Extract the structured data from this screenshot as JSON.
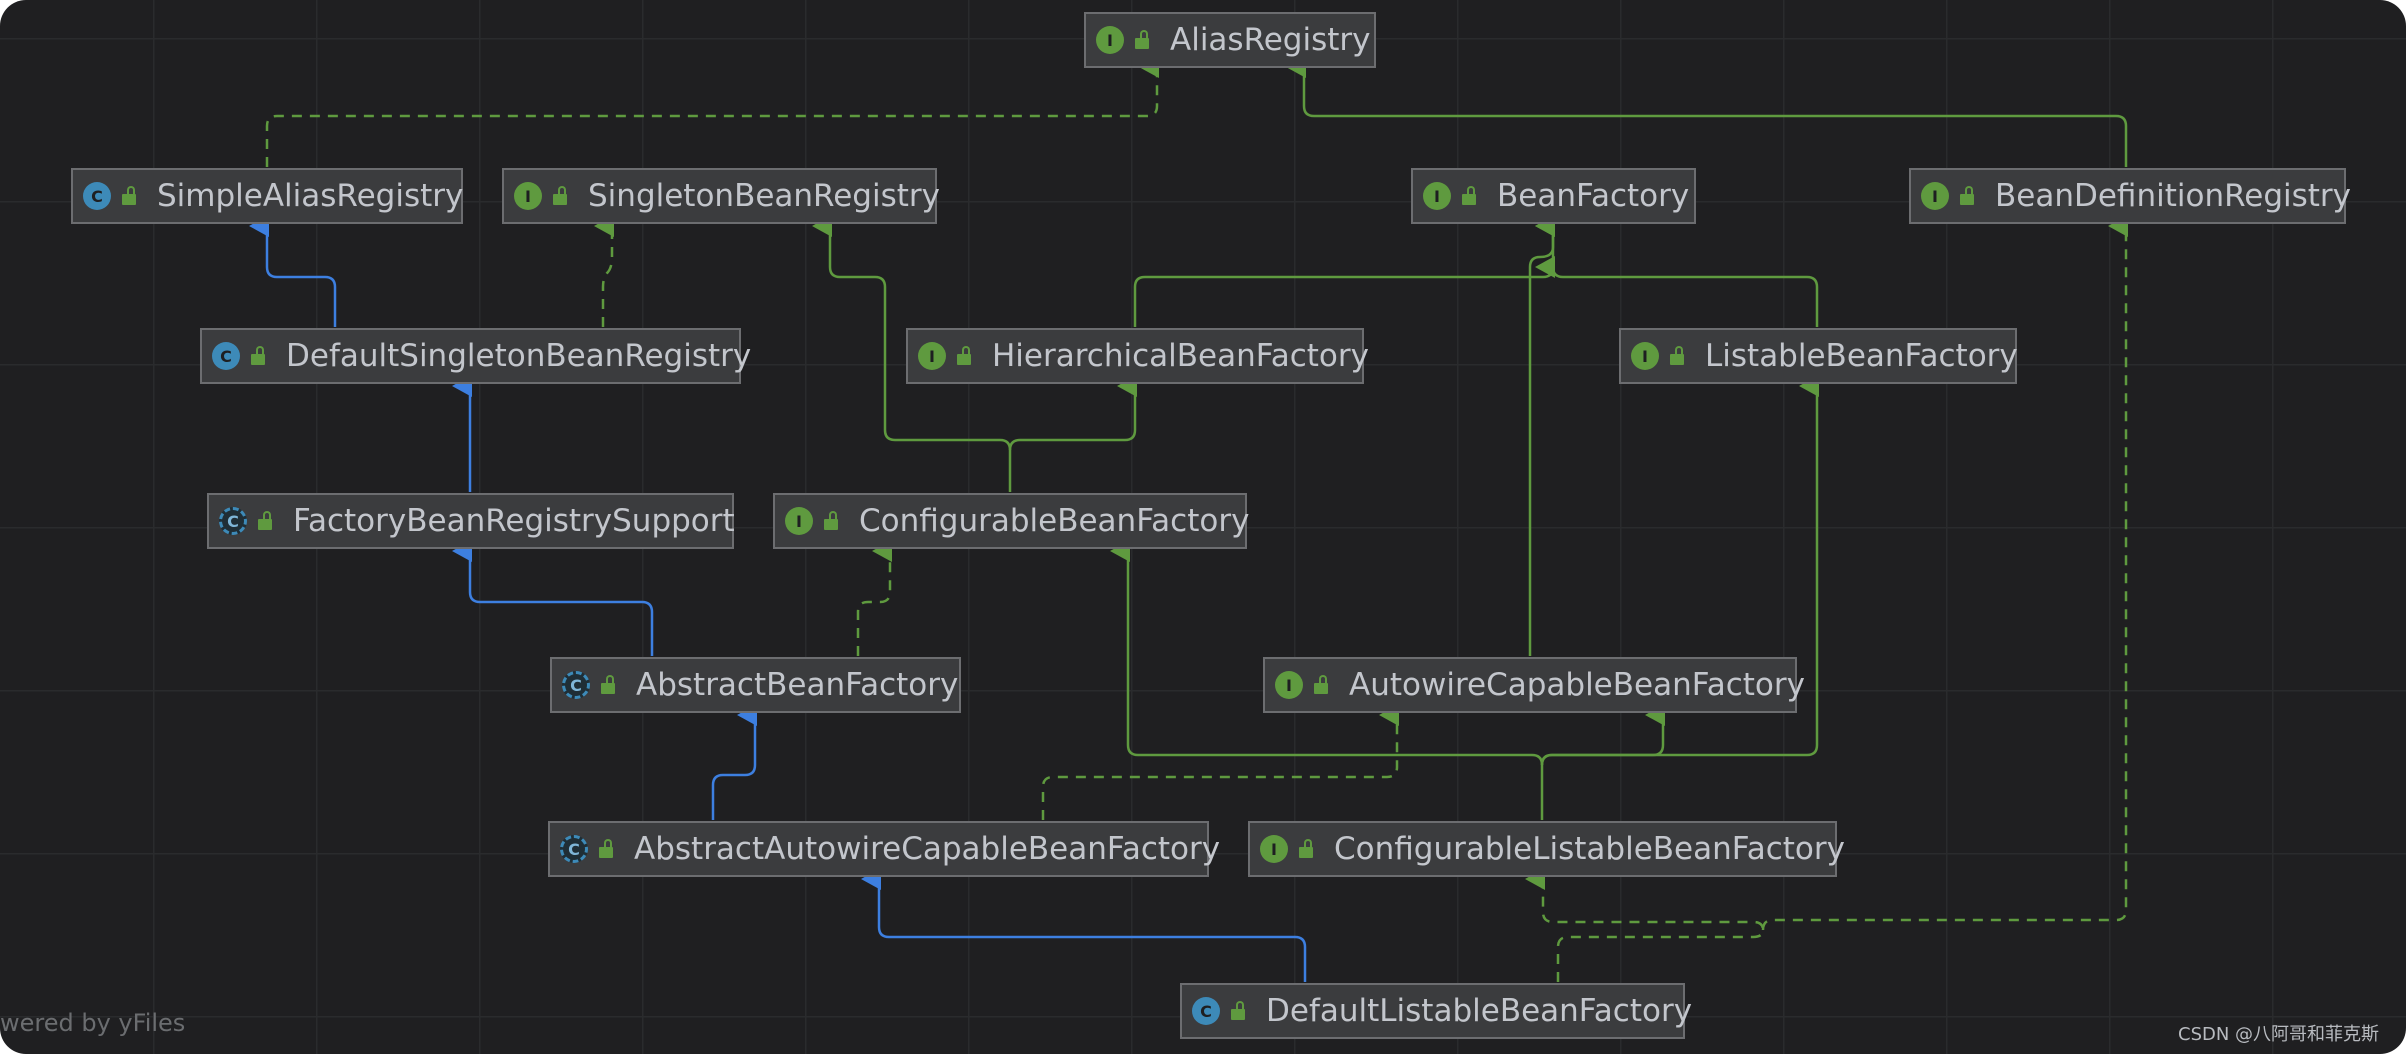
{
  "colors": {
    "implements_edge": "#5f9a3f",
    "extends_edge": "#3d7fe0",
    "interface_icon": "#5f9a3f",
    "class_icon": "#3d8ab8"
  },
  "nodes": {
    "alias_registry": {
      "label": "AliasRegistry",
      "kind": "interface",
      "kind_letter": "I"
    },
    "simple_alias_registry": {
      "label": "SimpleAliasRegistry",
      "kind": "class",
      "kind_letter": "C"
    },
    "singleton_bean_registry": {
      "label": "SingletonBeanRegistry",
      "kind": "interface",
      "kind_letter": "I"
    },
    "bean_factory": {
      "label": "BeanFactory",
      "kind": "interface",
      "kind_letter": "I"
    },
    "bean_definition_registry": {
      "label": "BeanDefinitionRegistry",
      "kind": "interface",
      "kind_letter": "I"
    },
    "default_singleton_bean_registry": {
      "label": "DefaultSingletonBeanRegistry",
      "kind": "class",
      "kind_letter": "C"
    },
    "hierarchical_bean_factory": {
      "label": "HierarchicalBeanFactory",
      "kind": "interface",
      "kind_letter": "I"
    },
    "listable_bean_factory": {
      "label": "ListableBeanFactory",
      "kind": "interface",
      "kind_letter": "I"
    },
    "factory_bean_registry_support": {
      "label": "FactoryBeanRegistrySupport",
      "kind": "abstract",
      "kind_letter": "C"
    },
    "configurable_bean_factory": {
      "label": "ConfigurableBeanFactory",
      "kind": "interface",
      "kind_letter": "I"
    },
    "abstract_bean_factory": {
      "label": "AbstractBeanFactory",
      "kind": "abstract",
      "kind_letter": "C"
    },
    "autowire_capable_bean_factory": {
      "label": "AutowireCapableBeanFactory",
      "kind": "interface",
      "kind_letter": "I"
    },
    "abstract_autowire_capable_bean_factory": {
      "label": "AbstractAutowireCapableBeanFactory",
      "kind": "abstract",
      "kind_letter": "C"
    },
    "configurable_listable_bean_factory": {
      "label": "ConfigurableListableBeanFactory",
      "kind": "interface",
      "kind_letter": "I"
    },
    "default_listable_bean_factory": {
      "label": "DefaultListableBeanFactory",
      "kind": "class",
      "kind_letter": "C"
    }
  },
  "edges": [
    {
      "from": "simple_alias_registry",
      "to": "alias_registry",
      "relation": "implements"
    },
    {
      "from": "bean_definition_registry",
      "to": "alias_registry",
      "relation": "extends"
    },
    {
      "from": "default_singleton_bean_registry",
      "to": "simple_alias_registry",
      "relation": "extends"
    },
    {
      "from": "default_singleton_bean_registry",
      "to": "singleton_bean_registry",
      "relation": "implements"
    },
    {
      "from": "hierarchical_bean_factory",
      "to": "bean_factory",
      "relation": "extends"
    },
    {
      "from": "listable_bean_factory",
      "to": "bean_factory",
      "relation": "extends"
    },
    {
      "from": "autowire_capable_bean_factory",
      "to": "bean_factory",
      "relation": "extends"
    },
    {
      "from": "factory_bean_registry_support",
      "to": "default_singleton_bean_registry",
      "relation": "extends"
    },
    {
      "from": "configurable_bean_factory",
      "to": "hierarchical_bean_factory",
      "relation": "extends"
    },
    {
      "from": "configurable_bean_factory",
      "to": "singleton_bean_registry",
      "relation": "extends"
    },
    {
      "from": "abstract_bean_factory",
      "to": "factory_bean_registry_support",
      "relation": "extends"
    },
    {
      "from": "abstract_bean_factory",
      "to": "configurable_bean_factory",
      "relation": "implements"
    },
    {
      "from": "abstract_autowire_capable_bean_factory",
      "to": "abstract_bean_factory",
      "relation": "extends"
    },
    {
      "from": "abstract_autowire_capable_bean_factory",
      "to": "autowire_capable_bean_factory",
      "relation": "implements"
    },
    {
      "from": "configurable_listable_bean_factory",
      "to": "configurable_bean_factory",
      "relation": "extends"
    },
    {
      "from": "configurable_listable_bean_factory",
      "to": "autowire_capable_bean_factory",
      "relation": "extends"
    },
    {
      "from": "configurable_listable_bean_factory",
      "to": "listable_bean_factory",
      "relation": "extends"
    },
    {
      "from": "default_listable_bean_factory",
      "to": "abstract_autowire_capable_bean_factory",
      "relation": "extends"
    },
    {
      "from": "default_listable_bean_factory",
      "to": "configurable_listable_bean_factory",
      "relation": "implements"
    },
    {
      "from": "default_listable_bean_factory",
      "to": "bean_definition_registry",
      "relation": "implements"
    }
  ],
  "watermark": "wered by yFiles",
  "credit": "CSDN @八阿哥和菲克斯"
}
